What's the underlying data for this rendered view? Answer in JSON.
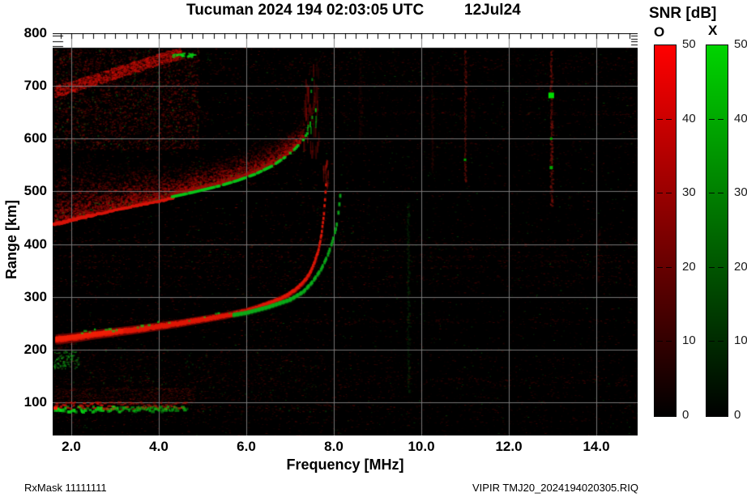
{
  "title": {
    "main": "Tucuman 2024 194 02:03:05 UTC",
    "date": "12Jul24"
  },
  "footer": {
    "left": "RxMask 11111111",
    "right": "VIPIR  TMJ20_2024194020305.RIQ"
  },
  "colorbar": {
    "title": "SNR [dB]",
    "o_label": "O",
    "x_label": "X",
    "tick_values": [
      50,
      40,
      30,
      20,
      10,
      0
    ],
    "o_color_top": "#ff0000",
    "x_color_top": "#00d400",
    "color_bottom": "#000000"
  },
  "chart_data": {
    "type": "heatmap",
    "title": "Tucuman 2024 194 02:03:05 UTC 12Jul24",
    "xlabel": "Frequency [MHz]",
    "ylabel": "Range [km]",
    "x_axis": {
      "ticks": [
        2,
        4,
        6,
        8,
        10,
        12,
        14
      ],
      "tick_labels": [
        "2.0",
        "4.0",
        "6.0",
        "8.0",
        "10.0",
        "12.0",
        "14.0"
      ],
      "range_mhz": [
        1.57,
        14.95
      ],
      "minor_tick_step_mhz": 0.25
    },
    "y_axis": {
      "ticks": [
        100,
        200,
        300,
        400,
        500,
        600,
        700,
        800
      ],
      "tick_labels": [
        "100",
        "200",
        "300",
        "400",
        "500",
        "600",
        "700",
        "800"
      ],
      "range_km": [
        37,
        772
      ]
    },
    "snr_scale_db": [
      0,
      50
    ],
    "grid": true,
    "traces": {
      "f_trace_o": {
        "mode": "O",
        "points": [
          [
            1.65,
            219
          ],
          [
            2.0,
            222
          ],
          [
            2.5,
            228
          ],
          [
            3.0,
            233
          ],
          [
            3.5,
            238
          ],
          [
            4.0,
            244
          ],
          [
            4.5,
            250
          ],
          [
            5.0,
            257
          ],
          [
            5.5,
            264
          ],
          [
            6.0,
            273
          ],
          [
            6.3,
            281
          ],
          [
            6.6,
            290
          ],
          [
            6.9,
            301
          ],
          [
            7.1,
            312
          ],
          [
            7.3,
            327
          ],
          [
            7.45,
            345
          ],
          [
            7.55,
            364
          ],
          [
            7.65,
            390
          ],
          [
            7.72,
            422
          ],
          [
            7.77,
            458
          ],
          [
            7.8,
            492
          ],
          [
            7.82,
            516
          ]
        ],
        "faint_top_extension_km": 562
      },
      "f_trace_x": {
        "mode": "X",
        "speckle_f_range": [
          1.9,
          5.7
        ],
        "speckle_offset_km": 8,
        "points": [
          [
            5.7,
            266
          ],
          [
            6.0,
            270
          ],
          [
            6.5,
            281
          ],
          [
            7.0,
            295
          ],
          [
            7.3,
            310
          ],
          [
            7.5,
            328
          ],
          [
            7.7,
            352
          ],
          [
            7.85,
            378
          ],
          [
            7.95,
            402
          ],
          [
            8.05,
            432
          ],
          [
            8.1,
            460
          ],
          [
            8.14,
            492
          ]
        ]
      },
      "second_hop_red_edge": {
        "points": [
          [
            1.6,
            437
          ],
          [
            2.0,
            445
          ],
          [
            2.5,
            455
          ],
          [
            3.0,
            464
          ],
          [
            3.5,
            473
          ],
          [
            4.0,
            481
          ],
          [
            4.35,
            488
          ]
        ]
      },
      "second_hop_green_edge": {
        "points": [
          [
            4.3,
            490
          ],
          [
            4.7,
            497
          ],
          [
            5.0,
            503
          ],
          [
            5.4,
            511
          ],
          [
            5.8,
            521
          ],
          [
            6.2,
            533
          ],
          [
            6.6,
            549
          ],
          [
            6.9,
            566
          ],
          [
            7.1,
            580
          ],
          [
            7.3,
            598
          ],
          [
            7.42,
            614
          ]
        ]
      },
      "top_arc": {
        "points": [
          [
            1.6,
            686
          ],
          [
            2.0,
            696
          ],
          [
            2.5,
            709
          ],
          [
            3.0,
            722
          ],
          [
            3.5,
            735
          ],
          [
            4.0,
            748
          ],
          [
            4.45,
            758
          ]
        ],
        "green_tip_f_range": [
          4.3,
          4.8
        ]
      },
      "e_layer": {
        "f_range": [
          1.6,
          4.6
        ],
        "tail_to_mhz": 8.1,
        "range_km": [
          80,
          96
        ],
        "halo_top_km": 128
      },
      "left_patch": {
        "f_range": [
          1.58,
          2.15
        ],
        "range_km": [
          164,
          198
        ]
      }
    },
    "diffuse_regions": {
      "second_hop_cloud": {
        "f_range": [
          1.6,
          7.3
        ],
        "count": 5200,
        "thickness_km": [
          [
            1.6,
            135
          ],
          [
            2.5,
            108
          ],
          [
            3.5,
            84
          ],
          [
            4.5,
            64
          ],
          [
            5.5,
            58
          ],
          [
            6.5,
            56
          ],
          [
            7.3,
            42
          ]
        ]
      },
      "upper_left_speckle": {
        "f_range": [
          1.6,
          4.9
        ],
        "range_km": [
          580,
          770
        ],
        "count": 2600
      },
      "asymptote_spread": {
        "f_range": [
          7.3,
          7.65
        ],
        "range_km": [
          560,
          770
        ],
        "red_streaks": 42,
        "green_dashes": 10
      },
      "sub_trace_speckle": {
        "f_range": [
          1.6,
          7.6
        ],
        "range_km": [
          105,
          205
        ],
        "count": 700
      }
    },
    "rfi_streaks": [
      {
        "f": 9.7,
        "range_km": [
          120,
          480
        ],
        "color": "green",
        "alpha": 0.16,
        "width": 4
      },
      {
        "f": 10.25,
        "range_km": [
          540,
          740
        ],
        "color": "red",
        "alpha": 0.15,
        "width": 3
      },
      {
        "f": 11.0,
        "range_km": [
          520,
          770
        ],
        "color": "red",
        "alpha": 0.42,
        "width": 3
      },
      {
        "f": 12.97,
        "range_km": [
          470,
          770
        ],
        "color": "red",
        "alpha": 0.52,
        "width": 4
      },
      {
        "f": 14.05,
        "range_km": [
          330,
          430
        ],
        "color": "red",
        "alpha": 0.15,
        "width": 3
      },
      {
        "f": 8.6,
        "range_km": [
          600,
          770
        ],
        "color": "red",
        "alpha": 0.12,
        "width": 5
      }
    ],
    "rfi_blobs": [
      {
        "f": 12.97,
        "range_km": 682,
        "color": "#00dc00",
        "size": 7
      },
      {
        "f": 12.97,
        "range_km": 600,
        "color": "#00a800",
        "size": 3
      },
      {
        "f": 12.97,
        "range_km": 545,
        "color": "#00a800",
        "size": 4
      },
      {
        "f": 11.0,
        "range_km": 560,
        "color": "#00a800",
        "size": 3
      }
    ],
    "noise": {
      "speck_count": 9000,
      "green_ratio": 0.1,
      "row_bands": 28,
      "seed": 42
    }
  }
}
